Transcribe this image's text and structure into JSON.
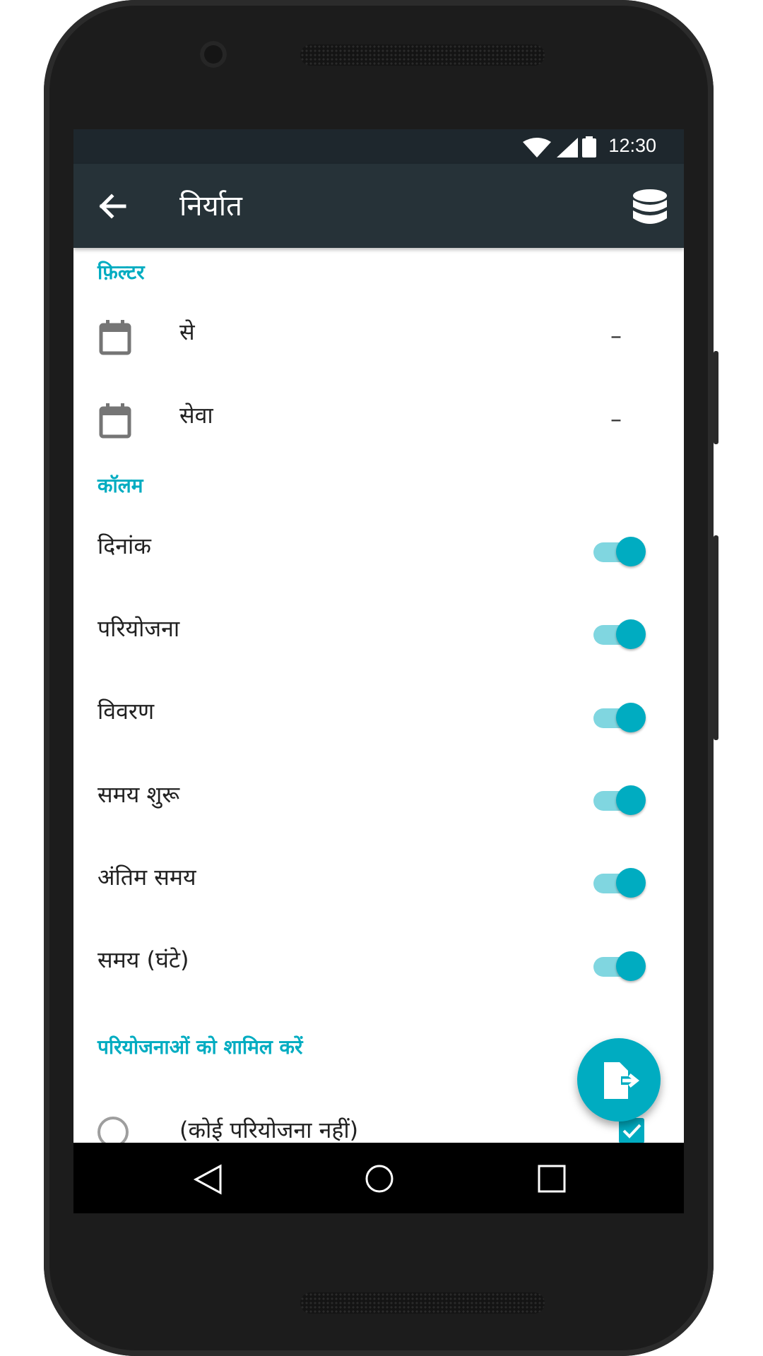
{
  "status_bar": {
    "time": "12:30"
  },
  "toolbar": {
    "title": "निर्यात"
  },
  "filter": {
    "header": "फ़िल्टर",
    "rows": [
      {
        "label": "से",
        "value": "–"
      },
      {
        "label": "सेवा",
        "value": "–"
      }
    ]
  },
  "columns": {
    "header": "कॉलम",
    "items": [
      {
        "label": "दिनांक",
        "enabled": true
      },
      {
        "label": "परियोजना",
        "enabled": true
      },
      {
        "label": "विवरण",
        "enabled": true
      },
      {
        "label": "समय शुरू",
        "enabled": true
      },
      {
        "label": "अंतिम समय",
        "enabled": true
      },
      {
        "label": "समय (घंटे)",
        "enabled": true
      }
    ]
  },
  "projects": {
    "header": "परियोजनाओं को शामिल करें",
    "items": [
      {
        "label": "(कोई परियोजना नहीं)",
        "checked": true
      }
    ]
  },
  "colors": {
    "accent": "#00acc1",
    "toolbar": "#263238",
    "status_bar": "#1e272d"
  },
  "icons": {
    "back": "arrow-left-icon",
    "database": "database-icon",
    "calendar": "calendar-icon",
    "fab": "export-file-icon"
  }
}
